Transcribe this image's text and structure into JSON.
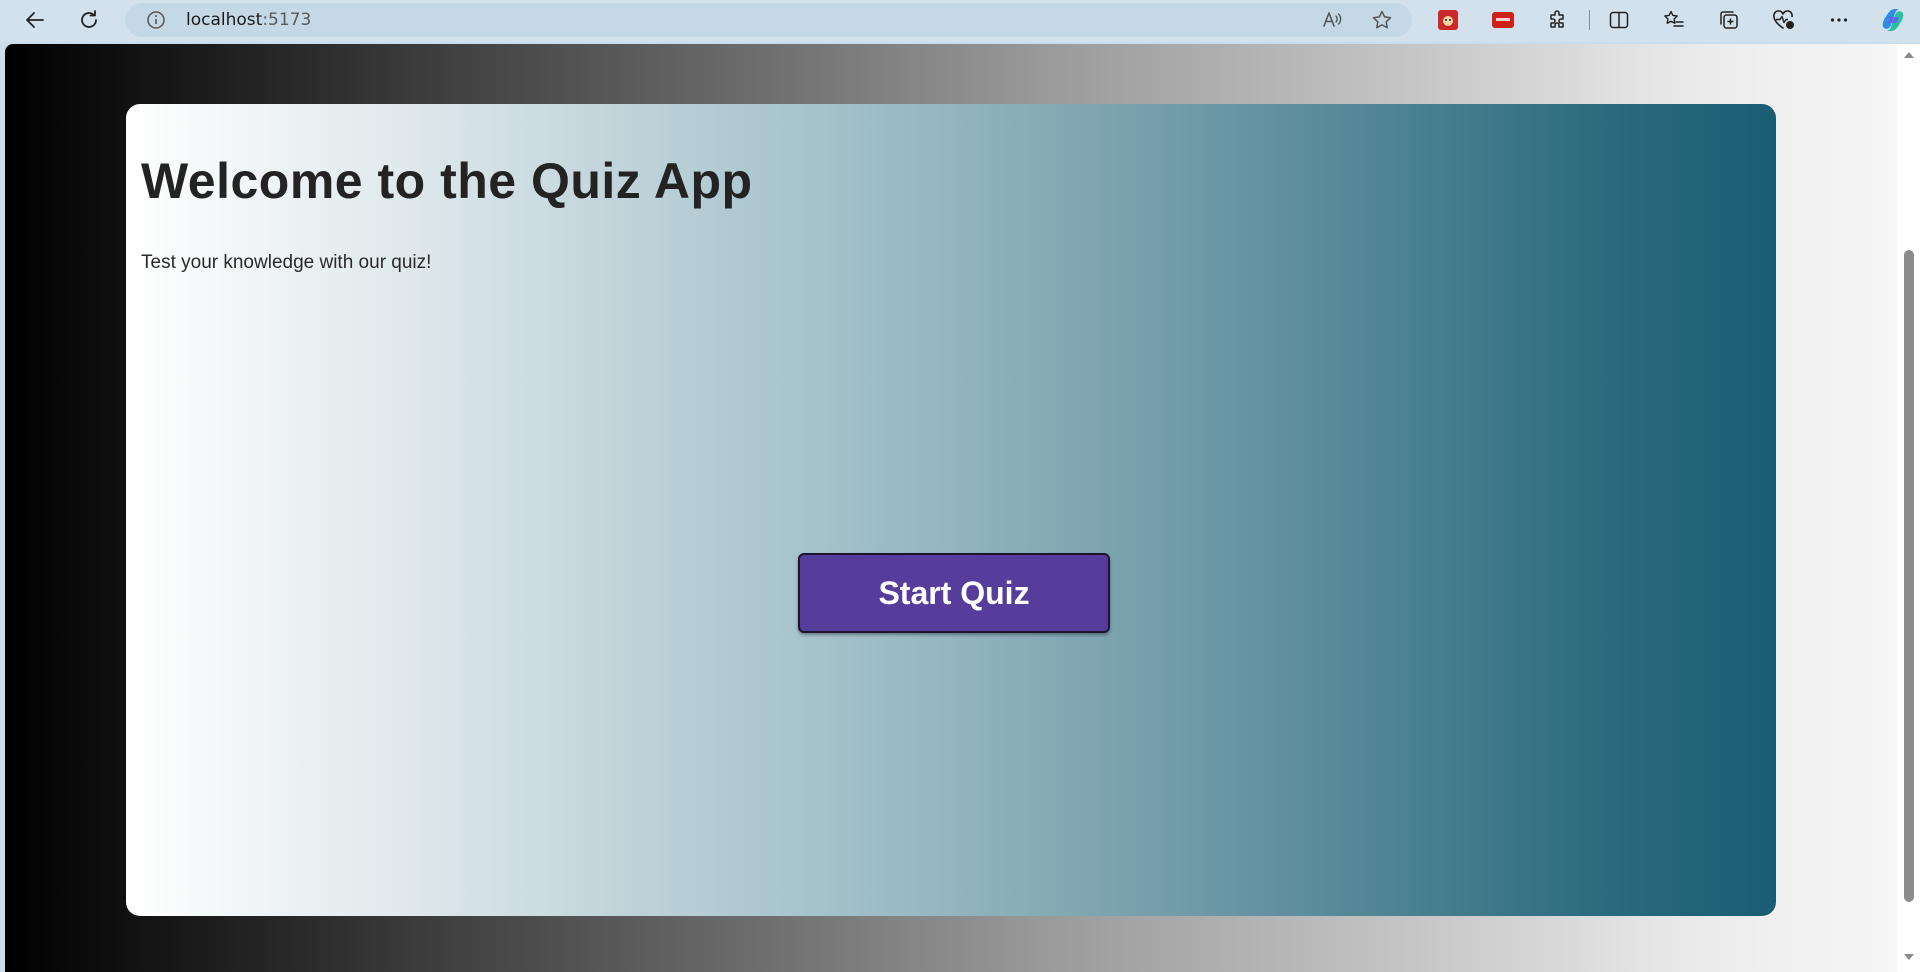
{
  "browser": {
    "address": {
      "host": "localhost",
      "port": ":5173"
    },
    "icons": {
      "back": "back-arrow-icon",
      "reload": "reload-icon",
      "site_info": "site-info-icon",
      "read_aloud": "read-aloud-icon",
      "favorite": "favorite-star-icon",
      "extension_1": "extension-icon",
      "extension_2": "extension-icon",
      "extensions": "puzzle-icon",
      "split_screen": "split-screen-icon",
      "favorites": "favorites-icon",
      "collections": "collections-icon",
      "browser_essentials": "heart-icon",
      "more": "more-icon",
      "copilot": "copilot-icon"
    }
  },
  "page": {
    "title": "Welcome to the Quiz App",
    "subtitle": "Test your knowledge with our quiz!",
    "start_button": "Start Quiz"
  },
  "colors": {
    "button_bg": "#563d9c",
    "card_gradient_start": "#ffffff",
    "card_gradient_end": "#1a5d73",
    "page_gradient_start": "#000000",
    "page_gradient_end": "#f6f6f6"
  }
}
